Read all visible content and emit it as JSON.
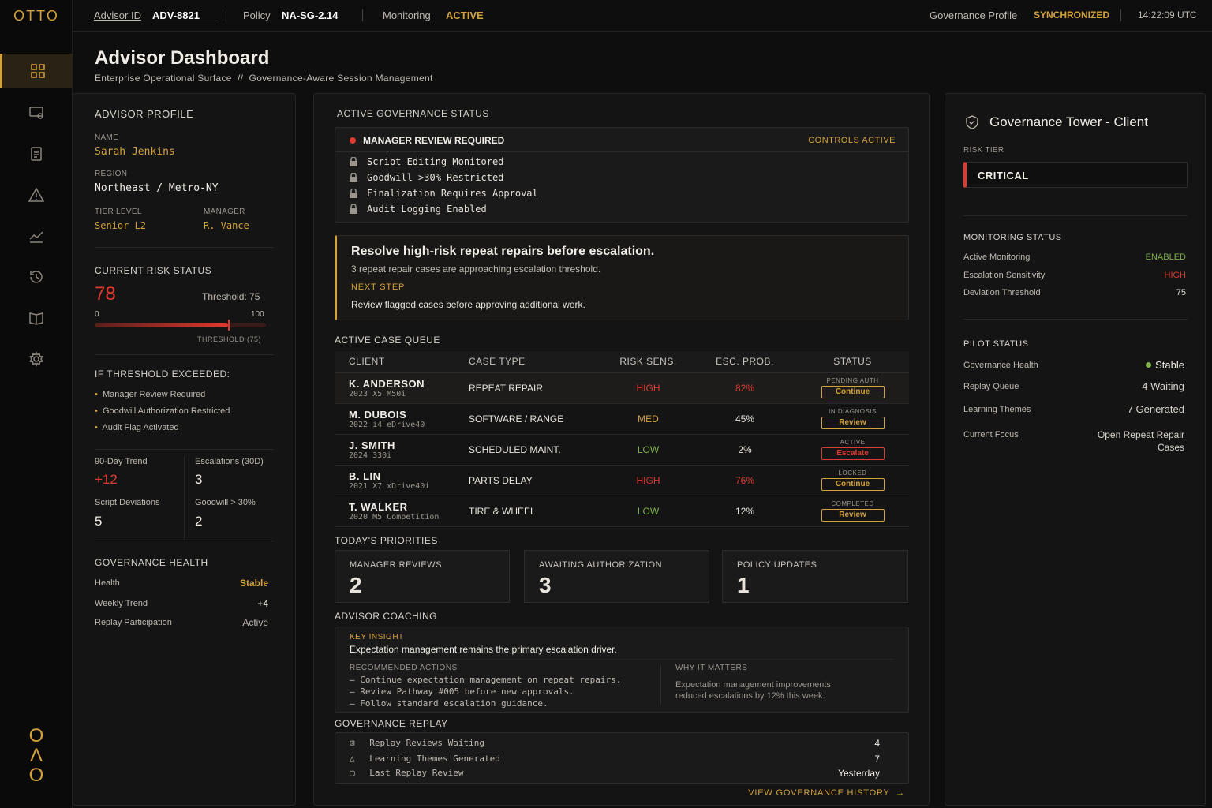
{
  "app": {
    "logo": "OTTO",
    "brand_mark": [
      "O",
      "Λ",
      "O"
    ]
  },
  "nav": [
    "dashboard",
    "monitor",
    "documents",
    "alerts",
    "trends",
    "history",
    "library",
    "settings"
  ],
  "topbar": {
    "advisor_label": "Advisor ID",
    "advisor_id": "ADV-8821",
    "policy_label": "Policy",
    "policy_val": "NA-SG-2.14",
    "monitoring_label": "Monitoring",
    "monitoring_val": "ACTIVE",
    "gov_profile_label": "Governance Profile",
    "gov_profile_val": "SYNCHRONIZED",
    "time": "14:22:09 UTC"
  },
  "header": {
    "title": "Advisor Dashboard",
    "subtitle": "Enterprise Operational Surface  //  Governance-Aware Session Management"
  },
  "profile": {
    "title": "ADVISOR PROFILE",
    "name_label": "NAME",
    "name": "Sarah Jenkins",
    "region_label": "REGION",
    "region": "Northeast / Metro-NY",
    "tier_label": "TIER LEVEL",
    "tier": "Senior L2",
    "manager_label": "MANAGER",
    "manager": "R. Vance"
  },
  "risk": {
    "title": "CURRENT RISK STATUS",
    "score": "78",
    "threshold_text": "Threshold: 75",
    "min": "0",
    "max": "100",
    "threshold_caption": "THRESHOLD (75)",
    "value": 78,
    "threshold": 75
  },
  "exceeded": {
    "title": "IF THRESHOLD EXCEEDED:",
    "items": [
      "Manager Review Required",
      "Goodwill Authorization Restricted",
      "Audit Flag Activated"
    ]
  },
  "stats": {
    "trend_label": "90-Day Trend",
    "trend": "+12",
    "esc_label": "Escalations (30D)",
    "esc": "3",
    "dev_label": "Script Deviations",
    "dev": "5",
    "goodwill_label": "Goodwill > 30%",
    "goodwill": "2"
  },
  "gov_health": {
    "title": "GOVERNANCE HEALTH",
    "health_label": "Health",
    "health": "Stable",
    "weekly_label": "Weekly Trend",
    "weekly": "+4",
    "replay_label": "Replay Participation",
    "replay": "Active"
  },
  "gov_status": {
    "title": "ACTIVE GOVERNANCE STATUS",
    "alert": "MANAGER REVIEW REQUIRED",
    "controls": "CONTROLS ACTIVE",
    "locks": [
      "Script Editing Monitored",
      "Goodwill >30% Restricted",
      "Finalization Requires Approval",
      "Audit Logging Enabled"
    ]
  },
  "callout": {
    "headline": "Resolve high-risk repeat repairs before escalation.",
    "detail": "3 repeat repair cases are approaching escalation threshold.",
    "next_label": "NEXT STEP",
    "next": "Review flagged cases before approving additional work."
  },
  "queue": {
    "title": "ACTIVE CASE QUEUE",
    "headers": [
      "CLIENT",
      "CASE TYPE",
      "RISK SENS.",
      "ESC. PROB.",
      "STATUS"
    ],
    "rows": [
      {
        "name": "K. ANDERSON",
        "car": "2023 X5 M50i",
        "type": "REPEAT REPAIR",
        "risk": "HIGH",
        "prob": "82%",
        "status": "PENDING AUTH",
        "action": "Continue"
      },
      {
        "name": "M. DUBOIS",
        "car": "2022 i4 eDrive40",
        "type": "SOFTWARE / RANGE",
        "risk": "MED",
        "prob": "45%",
        "status": "IN DIAGNOSIS",
        "action": "Review"
      },
      {
        "name": "J. SMITH",
        "car": "2024 330i",
        "type": "SCHEDULED MAINT.",
        "risk": "LOW",
        "prob": "2%",
        "status": "ACTIVE",
        "action": "Escalate"
      },
      {
        "name": "B. LIN",
        "car": "2021 X7 xDrive40i",
        "type": "PARTS DELAY",
        "risk": "HIGH",
        "prob": "76%",
        "status": "LOCKED",
        "action": "Continue"
      },
      {
        "name": "T. WALKER",
        "car": "2020 M5 Competition",
        "type": "TIRE & WHEEL",
        "risk": "LOW",
        "prob": "12%",
        "status": "COMPLETED",
        "action": "Review"
      }
    ]
  },
  "priorities": {
    "title": "TODAY'S PRIORITIES",
    "items": [
      {
        "label": "MANAGER REVIEWS",
        "value": "2"
      },
      {
        "label": "AWAITING AUTHORIZATION",
        "value": "3"
      },
      {
        "label": "POLICY UPDATES",
        "value": "1"
      }
    ]
  },
  "coaching": {
    "title": "ADVISOR COACHING",
    "insight_label": "KEY INSIGHT",
    "insight": "Expectation management remains the primary escalation driver.",
    "actions_label": "RECOMMENDED ACTIONS",
    "actions": [
      "– Continue expectation management on repeat repairs.",
      "– Review Pathway #005 before new approvals.",
      "– Follow standard escalation guidance."
    ],
    "why_label": "WHY IT MATTERS",
    "why": [
      "Expectation management improvements",
      "reduced escalations by 12% this week."
    ]
  },
  "replay": {
    "title": "GOVERNANCE REPLAY",
    "rows": [
      {
        "label": "Replay Reviews Waiting",
        "value": "4"
      },
      {
        "label": "Learning Themes Generated",
        "value": "7"
      },
      {
        "label": "Last Replay Review",
        "value": "Yesterday"
      }
    ],
    "link": "VIEW GOVERNANCE HISTORY"
  },
  "tower": {
    "title": "Governance Tower - Client",
    "tier_label": "RISK TIER",
    "tier": "CRITICAL",
    "monitoring_title": "MONITORING STATUS",
    "active_label": "Active Monitoring",
    "active": "ENABLED",
    "sens_label": "Escalation Sensitivity",
    "sens": "HIGH",
    "dev_label": "Deviation Threshold",
    "dev": "75",
    "pilot_title": "PILOT STATUS",
    "health_label": "Governance Health",
    "health": "Stable",
    "queue_label": "Replay Queue",
    "queue": "4 Waiting",
    "themes_label": "Learning Themes",
    "themes": "7 Generated",
    "focus_label": "Current Focus",
    "focus1": "Open Repeat Repair",
    "focus2": "Cases"
  },
  "colors": {
    "accent": "#d4a23c",
    "danger": "#e0392f",
    "ok": "#7fb04a"
  }
}
